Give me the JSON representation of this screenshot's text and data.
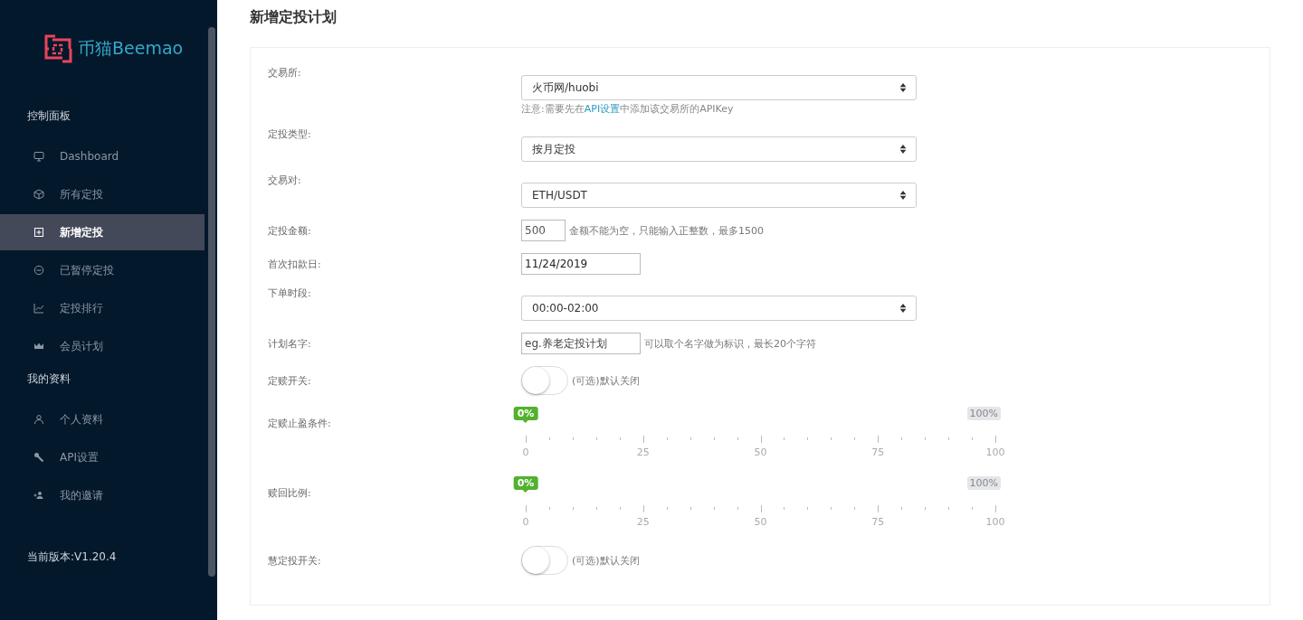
{
  "sidebar": {
    "logo_text": "币猫Beemao",
    "sections": [
      {
        "title": "控制面板",
        "items": [
          {
            "label": "Dashboard",
            "selected": false
          },
          {
            "label": "所有定投",
            "selected": false
          },
          {
            "label": "新增定投",
            "selected": true
          },
          {
            "label": "已暂停定投",
            "selected": false
          },
          {
            "label": "定投排行",
            "selected": false
          },
          {
            "label": "会员计划",
            "selected": false
          }
        ]
      },
      {
        "title": "我的资料",
        "items": [
          {
            "label": "个人资料",
            "selected": false
          },
          {
            "label": "API设置",
            "selected": false
          },
          {
            "label": "我的邀请",
            "selected": false
          }
        ]
      }
    ],
    "version": "当前版本:V1.20.4"
  },
  "page_title": "新增定投计划",
  "form": {
    "rows": [
      {
        "kind": "select",
        "label": "交易所:",
        "value": "火币网/huobi",
        "note": {
          "before": "注意:需要先在",
          "link": "API设置",
          "after": "中添加该交易所的APIKey"
        }
      },
      {
        "kind": "select",
        "label": "定投类型:",
        "value": "按月定投"
      },
      {
        "kind": "select",
        "label": "交易对:",
        "value": "ETH/USDT"
      },
      {
        "kind": "input",
        "label": "定投金额:",
        "value": "500",
        "hint": "金额不能为空，只能输入正整数，最多1500"
      },
      {
        "kind": "date",
        "label": "首次扣款日:",
        "value": "11/24/2019"
      },
      {
        "kind": "select",
        "label": "下单时段:",
        "value": "00:00-02:00"
      },
      {
        "kind": "text",
        "label": "计划名字:",
        "placeholder": "eg.养老定投计划",
        "hint": "可以取个名字做为标识，最长20个字符"
      },
      {
        "kind": "toggle",
        "label": "定赎开关:",
        "on": false,
        "hint": "(可选)默认关闭"
      },
      {
        "kind": "slider",
        "label": "定赎止盈条件:",
        "level": 0,
        "value_label": "0%",
        "max_label": "100%",
        "ticks": [
          "0",
          "25",
          "50",
          "75",
          "100"
        ]
      },
      {
        "kind": "slider",
        "label": "赎回比例:",
        "level": 0,
        "value_label": "0%",
        "max_label": "100%",
        "ticks": [
          "0",
          "25",
          "50",
          "75",
          "100"
        ]
      },
      {
        "kind": "toggle",
        "label": "慧定投开关:",
        "on": false,
        "hint": "(可选)默认关闭"
      }
    ]
  }
}
